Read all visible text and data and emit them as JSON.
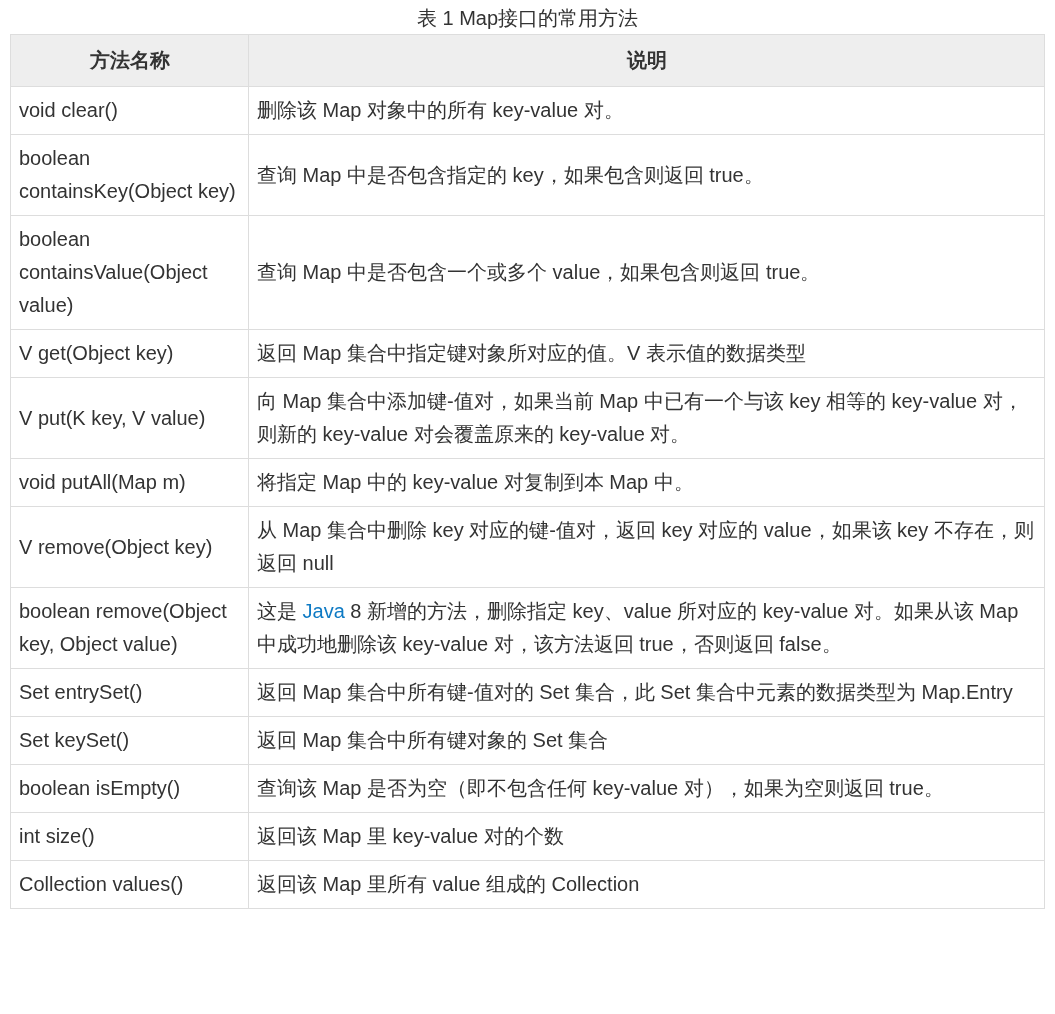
{
  "caption": "表 1 Map接口的常用方法",
  "table": {
    "columns": [
      "方法名称",
      "说明"
    ],
    "rows": [
      {
        "method": "void clear()",
        "description": [
          {
            "kind": "text",
            "text": "删除该 Map 对象中的所有 key-value 对。"
          }
        ]
      },
      {
        "method": "boolean containsKey(Object key)",
        "description": [
          {
            "kind": "text",
            "text": "查询 Map 中是否包含指定的 key，如果包含则返回 true。"
          }
        ]
      },
      {
        "method": "boolean containsValue(Object value)",
        "description": [
          {
            "kind": "text",
            "text": "查询 Map 中是否包含一个或多个 value，如果包含则返回 true。"
          }
        ]
      },
      {
        "method": "V get(Object key)",
        "description": [
          {
            "kind": "text",
            "text": "返回 Map 集合中指定键对象所对应的值。V 表示值的数据类型"
          }
        ]
      },
      {
        "method": "V put(K key, V value)",
        "description": [
          {
            "kind": "text",
            "text": "向 Map 集合中添加键-值对，如果当前 Map 中已有一个与该 key 相等的 key-value 对，则新的 key-value 对会覆盖原来的 key-value 对。"
          }
        ]
      },
      {
        "method": "void putAll(Map m)",
        "description": [
          {
            "kind": "text",
            "text": "将指定 Map 中的 key-value 对复制到本 Map 中。"
          }
        ]
      },
      {
        "method": "V remove(Object key)",
        "description": [
          {
            "kind": "text",
            "text": "从 Map 集合中删除 key 对应的键-值对，返回 key 对应的 value，如果该 key 不存在，则返回 null"
          }
        ]
      },
      {
        "method": "boolean remove(Object key, Object value)",
        "description": [
          {
            "kind": "text",
            "text": "这是 "
          },
          {
            "kind": "link",
            "text": "Java"
          },
          {
            "kind": "text",
            "text": " 8 新增的方法，删除指定 key、value 所对应的 key-value 对。如果从该 Map 中成功地删除该 key-value 对，该方法返回 true，否则返回 false。"
          }
        ]
      },
      {
        "method": "Set entrySet()",
        "description": [
          {
            "kind": "text",
            "text": "返回 Map 集合中所有键-值对的 Set 集合，此 Set 集合中元素的数据类型为 Map.Entry"
          }
        ]
      },
      {
        "method": "Set keySet()",
        "description": [
          {
            "kind": "text",
            "text": "返回 Map 集合中所有键对象的 Set 集合"
          }
        ]
      },
      {
        "method": "boolean isEmpty()",
        "description": [
          {
            "kind": "text",
            "text": "查询该 Map 是否为空（即不包含任何 key-value 对），如果为空则返回 true。"
          }
        ]
      },
      {
        "method": "int size()",
        "description": [
          {
            "kind": "text",
            "text": "返回该 Map 里 key-value 对的个数"
          }
        ]
      },
      {
        "method": "Collection values()",
        "description": [
          {
            "kind": "text",
            "text": "返回该 Map 里所有 value 组成的 Collection"
          }
        ]
      }
    ]
  }
}
